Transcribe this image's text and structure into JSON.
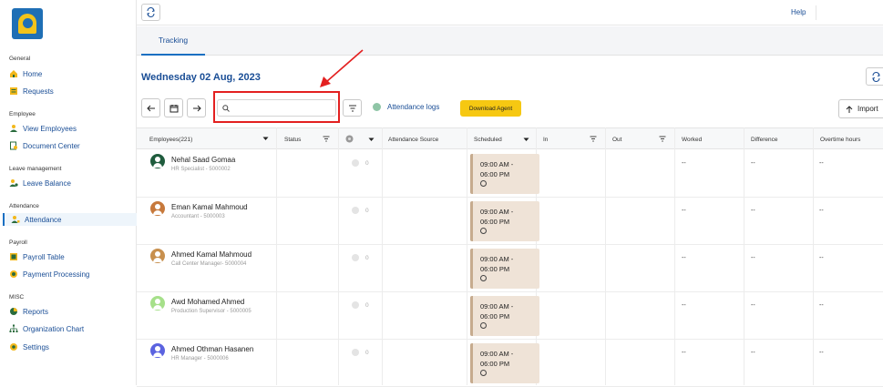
{
  "sidebar": {
    "sections": [
      {
        "title": "General",
        "items": [
          {
            "label": "Home",
            "icon": "home-icon"
          },
          {
            "label": "Requests",
            "icon": "requests-icon"
          }
        ]
      },
      {
        "title": "Employee",
        "items": [
          {
            "label": "View Employees",
            "icon": "employees-icon"
          },
          {
            "label": "Document Center",
            "icon": "document-icon"
          }
        ]
      },
      {
        "title": "Leave management",
        "items": [
          {
            "label": "Leave Balance",
            "icon": "leave-icon"
          }
        ]
      },
      {
        "title": "Attendance",
        "items": [
          {
            "label": "Attendance",
            "icon": "attendance-icon",
            "active": true
          }
        ]
      },
      {
        "title": "Payroll",
        "items": [
          {
            "label": "Payroll Table",
            "icon": "payroll-icon"
          },
          {
            "label": "Payment Processing",
            "icon": "payment-icon"
          }
        ]
      },
      {
        "title": "MISC",
        "items": [
          {
            "label": "Reports",
            "icon": "reports-icon"
          },
          {
            "label": "Organization Chart",
            "icon": "org-chart-icon"
          },
          {
            "label": "Settings",
            "icon": "settings-icon"
          }
        ]
      }
    ]
  },
  "topbar": {
    "help_label": "Help"
  },
  "tabs": [
    {
      "label": "Tracking",
      "active": true
    }
  ],
  "page": {
    "date": "Wednesday 02 Aug, 2023"
  },
  "toolbar": {
    "search_placeholder": "",
    "attendance_logs_label": "Attendance logs",
    "download_agent_label": "Download Agent",
    "import_label": "Import"
  },
  "table": {
    "columns": {
      "employees": "Employees(221)",
      "status": "Status",
      "attendance_source": "Attendance Source",
      "scheduled": "Scheduled",
      "in": "In",
      "out": "Out",
      "worked": "Worked",
      "difference": "Difference",
      "overtime": "Overtime hours"
    },
    "rows": [
      {
        "name": "Nehal Saad Gomaa",
        "role": "HR Specialist - 5000002",
        "avatar_color": "#1f5c3d",
        "count": "0",
        "sched_start": "09:00 AM -",
        "sched_end": "06:00 PM",
        "worked": "--",
        "difference": "--",
        "overtime": "--"
      },
      {
        "name": "Eman Kamal Mahmoud",
        "role": "Accountant - 5000003",
        "avatar_color": "#c7793c",
        "count": "0",
        "sched_start": "09:00 AM -",
        "sched_end": "06:00 PM",
        "worked": "--",
        "difference": "--",
        "overtime": "--"
      },
      {
        "name": "Ahmed Kamal Mahmoud",
        "role": "Call Center Manager- 5000004",
        "avatar_color": "#c8904e",
        "count": "0",
        "sched_start": "09:00 AM -",
        "sched_end": "06:00 PM",
        "worked": "--",
        "difference": "--",
        "overtime": "--"
      },
      {
        "name": "Awd Mohamed Ahmed",
        "role": "Production Supervisor - 5000005",
        "avatar_color": "#a6e08a",
        "count": "0",
        "sched_start": "09:00 AM -",
        "sched_end": "06:00 PM",
        "worked": "--",
        "difference": "--",
        "overtime": "--"
      },
      {
        "name": "Ahmed Othman Hasanen",
        "role": "HR Manager - 5000006",
        "avatar_color": "#5b63e0",
        "count": "0",
        "sched_start": "09:00 AM -",
        "sched_end": "06:00 PM",
        "worked": "--",
        "difference": "--",
        "overtime": "--"
      }
    ]
  },
  "colors": {
    "accent": "#1a4e96",
    "highlight": "#e32020",
    "download": "#f6c812"
  }
}
